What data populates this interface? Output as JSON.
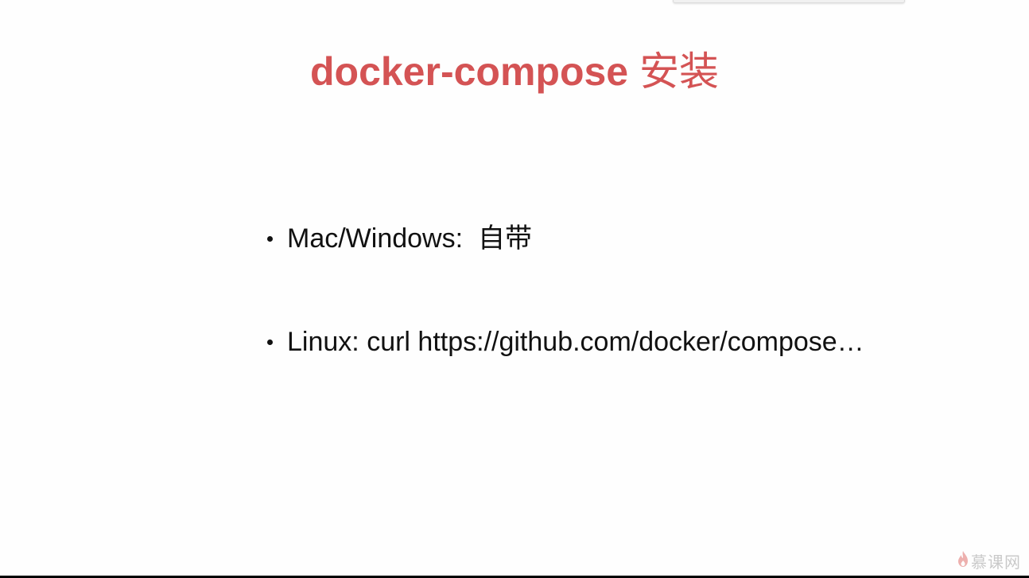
{
  "slide": {
    "title_en": "docker-compose",
    "title_zh": "安装",
    "bullets": [
      {
        "label": "Mac/Windows:",
        "text": "自带"
      },
      {
        "label": "Linux:",
        "text": "curl https://github.com/docker/compose…"
      }
    ]
  },
  "watermark": {
    "logo_text": "慕课网",
    "icon": "flame-icon"
  },
  "colors": {
    "title": "#d45354",
    "text": "#111111",
    "background": "#fefefe"
  }
}
